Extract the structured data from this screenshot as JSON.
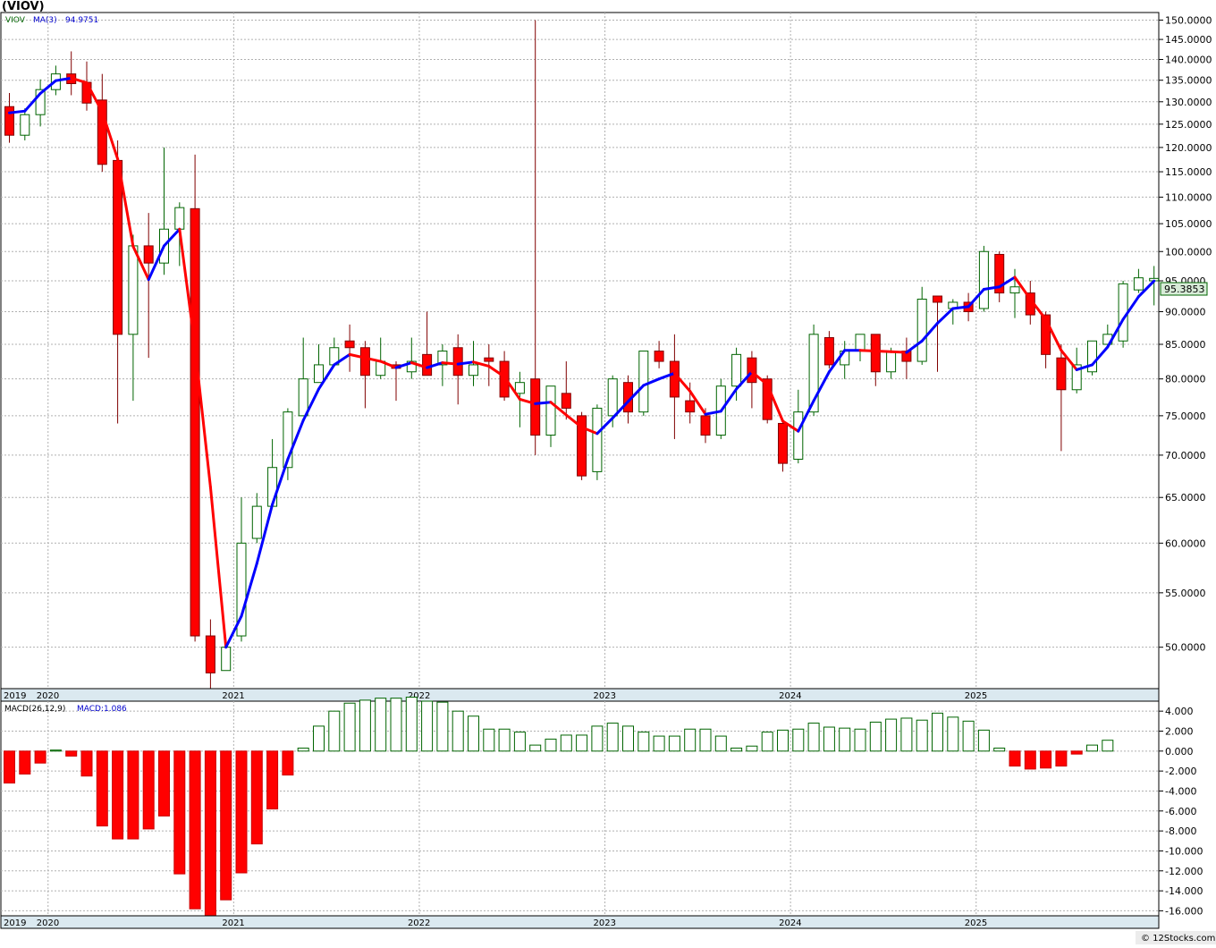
{
  "page_title": "(VIOV)",
  "legend": {
    "symbol": "VIOV",
    "ma_label": "MA(3)",
    "ma_value": "94.9751"
  },
  "last_price_label": "95.3853",
  "macd_legend": {
    "label": "MACD(26,12,9)",
    "value_label": "MACD:1.086"
  },
  "watermark": "© 12Stocks.com",
  "colors": {
    "up_candle_fill": "#ffffff",
    "up_candle_stroke": "#006400",
    "down_candle_fill": "#ff0000",
    "down_candle_stroke": "#800000",
    "ma_up": "#0000ff",
    "ma_down": "#ff0000",
    "macd_pos": "#006400",
    "macd_neg": "#ff0000",
    "band": "#dbe9f0",
    "last_price_box": "#d8ecd8"
  },
  "chart_data": [
    {
      "type": "candlestick",
      "period": "monthly",
      "x_start": "2019-10",
      "years": [
        "2019",
        "2020",
        "2021",
        "2022",
        "2023",
        "2024",
        "2025"
      ],
      "y_ticks": [
        "150.0000",
        "145.0000",
        "140.0000",
        "135.0000",
        "130.0000",
        "125.0000",
        "120.0000",
        "115.0000",
        "110.0000",
        "105.0000",
        "100.0000",
        "95.0000",
        "90.0000",
        "85.0000",
        "80.0000",
        "75.0000",
        "70.0000",
        "65.0000",
        "60.0000",
        "55.0000",
        "50.0000"
      ],
      "y_scale": "log",
      "ylim": [
        46.5,
        152
      ],
      "series": [
        {
          "name": "VIOV",
          "ohlc": [
            [
              128.9,
              132.0,
              121.0,
              122.6
            ],
            [
              122.6,
              128.5,
              121.5,
              127.1
            ],
            [
              127.1,
              135.2,
              124.5,
              132.8
            ],
            [
              132.8,
              138.5,
              131.5,
              136.5
            ],
            [
              136.5,
              142.0,
              131.5,
              134.2
            ],
            [
              134.5,
              139.5,
              128.0,
              129.7
            ],
            [
              130.4,
              136.5,
              115.0,
              116.5
            ],
            [
              117.3,
              121.5,
              74.0,
              86.5
            ],
            [
              86.5,
              103.0,
              77.0,
              101.0
            ],
            [
              101.0,
              107.0,
              83.0,
              98.0
            ],
            [
              98.0,
              120.0,
              96.0,
              104.0
            ],
            [
              104.0,
              109.0,
              97.5,
              108.0
            ],
            [
              107.8,
              118.5,
              50.5,
              51.0
            ],
            [
              51.0,
              52.5,
              46.5,
              47.8
            ],
            [
              48.0,
              50.5,
              48.0,
              50.0
            ],
            [
              51.0,
              65.0,
              50.5,
              60.0
            ],
            [
              60.5,
              65.5,
              60.0,
              64.0
            ],
            [
              64.0,
              72.0,
              64.0,
              68.5
            ],
            [
              68.5,
              76.0,
              67.0,
              75.5
            ],
            [
              75.0,
              86.0,
              75.0,
              80.0
            ],
            [
              79.5,
              85.0,
              79.5,
              82.0
            ],
            [
              82.0,
              86.0,
              82.0,
              84.5
            ],
            [
              85.5,
              88.0,
              81.0,
              84.5
            ],
            [
              84.5,
              85.5,
              76.0,
              80.5
            ],
            [
              80.5,
              86.0,
              80.0,
              82.5
            ],
            [
              82.0,
              82.5,
              77.0,
              81.5
            ],
            [
              81.0,
              86.0,
              80.0,
              82.5
            ],
            [
              83.5,
              90.0,
              80.5,
              80.5
            ],
            [
              82.0,
              85.0,
              79.0,
              84.0
            ],
            [
              84.5,
              86.5,
              76.5,
              80.5
            ],
            [
              80.5,
              85.5,
              79.0,
              82.0
            ],
            [
              83.0,
              85.0,
              79.0,
              82.5
            ],
            [
              82.5,
              84.0,
              77.0,
              77.5
            ],
            [
              78.0,
              81.0,
              73.5,
              79.5
            ],
            [
              80.0,
              150.0,
              70.0,
              72.5
            ],
            [
              72.5,
              79.0,
              71.0,
              79.0
            ],
            [
              78.0,
              82.5,
              74.5,
              76.0
            ],
            [
              75.0,
              75.5,
              67.0,
              67.5
            ],
            [
              68.0,
              76.5,
              67.0,
              76.0
            ],
            [
              75.0,
              80.5,
              73.5,
              80.0
            ],
            [
              79.5,
              80.5,
              74.0,
              75.5
            ],
            [
              75.5,
              84.0,
              75.0,
              84.0
            ],
            [
              84.0,
              85.5,
              81.5,
              82.5
            ],
            [
              82.5,
              86.5,
              72.0,
              77.5
            ],
            [
              77.0,
              79.5,
              74.0,
              75.5
            ],
            [
              75.0,
              76.0,
              71.5,
              72.5
            ],
            [
              72.5,
              80.0,
              72.0,
              79.0
            ],
            [
              79.0,
              84.5,
              77.0,
              83.5
            ],
            [
              83.0,
              84.0,
              76.0,
              79.5
            ],
            [
              80.0,
              80.5,
              74.0,
              74.5
            ],
            [
              74.0,
              74.5,
              68.0,
              69.0
            ],
            [
              69.5,
              78.5,
              69.0,
              75.5
            ],
            [
              75.5,
              88.0,
              75.0,
              86.5
            ],
            [
              86.0,
              87.0,
              81.5,
              82.0
            ],
            [
              82.0,
              85.5,
              80.0,
              84.0
            ],
            [
              84.0,
              86.5,
              82.5,
              86.5
            ],
            [
              86.5,
              86.5,
              79.0,
              81.0
            ],
            [
              81.0,
              84.5,
              80.0,
              84.0
            ],
            [
              84.0,
              86.0,
              80.0,
              82.5
            ],
            [
              82.5,
              94.0,
              82.0,
              92.0
            ],
            [
              92.5,
              92.5,
              81.0,
              91.5
            ],
            [
              90.5,
              92.0,
              88.0,
              91.5
            ],
            [
              91.5,
              93.0,
              88.5,
              90.0
            ],
            [
              90.5,
              101.0,
              90.0,
              100.0
            ],
            [
              99.5,
              100.0,
              91.5,
              93.0
            ],
            [
              93.0,
              97.0,
              89.0,
              94.0
            ],
            [
              93.0,
              95.0,
              88.0,
              89.5
            ],
            [
              89.5,
              90.0,
              81.5,
              83.5
            ],
            [
              83.0,
              85.0,
              70.5,
              78.5
            ],
            [
              78.5,
              84.5,
              78.0,
              82.0
            ],
            [
              81.0,
              85.5,
              80.5,
              85.5
            ],
            [
              85.0,
              88.0,
              84.5,
              86.5
            ],
            [
              85.5,
              95.0,
              84.5,
              94.5
            ],
            [
              93.5,
              97.0,
              93.0,
              95.5
            ],
            [
              95.0,
              97.5,
              91.0,
              95.4
            ]
          ]
        },
        {
          "name": "MA(3)",
          "values": [
            127.5,
            127.9,
            131.9,
            134.9,
            135.5,
            134.4,
            127.7,
            117.6,
            100.9,
            95.2,
            101.0,
            104.0,
            84.6,
            66.2,
            50.0,
            52.8,
            57.9,
            64.2,
            69.5,
            74.4,
            78.6,
            82.0,
            83.5,
            83.0,
            82.5,
            81.6,
            82.3,
            81.6,
            82.3,
            82.1,
            82.4,
            81.8,
            80.3,
            77.2,
            76.6,
            76.8,
            75.1,
            73.5,
            72.7,
            74.7,
            76.9,
            79.1,
            80.0,
            80.8,
            78.3,
            75.2,
            75.6,
            78.6,
            81.0,
            79.2,
            74.3,
            73.0,
            77.0,
            81.0,
            84.1,
            84.1,
            84.0,
            83.9,
            83.8,
            85.5,
            88.2,
            90.5,
            90.8,
            93.6,
            94.0,
            95.6,
            92.0,
            88.8,
            84.1,
            81.3,
            82.0,
            84.6,
            88.8,
            92.4,
            94.9751
          ]
        }
      ]
    },
    {
      "type": "bar",
      "name": "MACD(26,12,9)",
      "y_ticks": [
        "4.000",
        "2.000",
        "0.000",
        "-2.000",
        "-4.000",
        "-6.000",
        "-8.000",
        "-10.000",
        "-12.000",
        "-14.000",
        "-16.000"
      ],
      "ylim": [
        -16.5,
        5.0
      ],
      "values": [
        -3.2,
        -2.3,
        -1.2,
        0.1,
        -0.5,
        -2.5,
        -7.5,
        -8.8,
        -8.8,
        -7.8,
        -6.5,
        -12.3,
        -15.8,
        -16.5,
        -14.9,
        -12.2,
        -9.3,
        -5.8,
        -2.4,
        0.3,
        2.5,
        4.0,
        4.8,
        5.1,
        5.3,
        5.3,
        5.4,
        5.0,
        4.9,
        4.0,
        3.5,
        2.2,
        2.2,
        1.9,
        0.6,
        1.2,
        1.6,
        1.6,
        2.5,
        2.8,
        2.5,
        1.9,
        1.5,
        1.5,
        2.2,
        2.2,
        1.5,
        0.3,
        0.5,
        1.9,
        2.1,
        2.2,
        2.8,
        2.4,
        2.3,
        2.2,
        2.9,
        3.2,
        3.3,
        3.1,
        3.8,
        3.4,
        3.0,
        2.1,
        0.3,
        -1.5,
        -1.8,
        -1.7,
        -1.5,
        -0.3,
        0.6,
        1.086
      ]
    }
  ]
}
